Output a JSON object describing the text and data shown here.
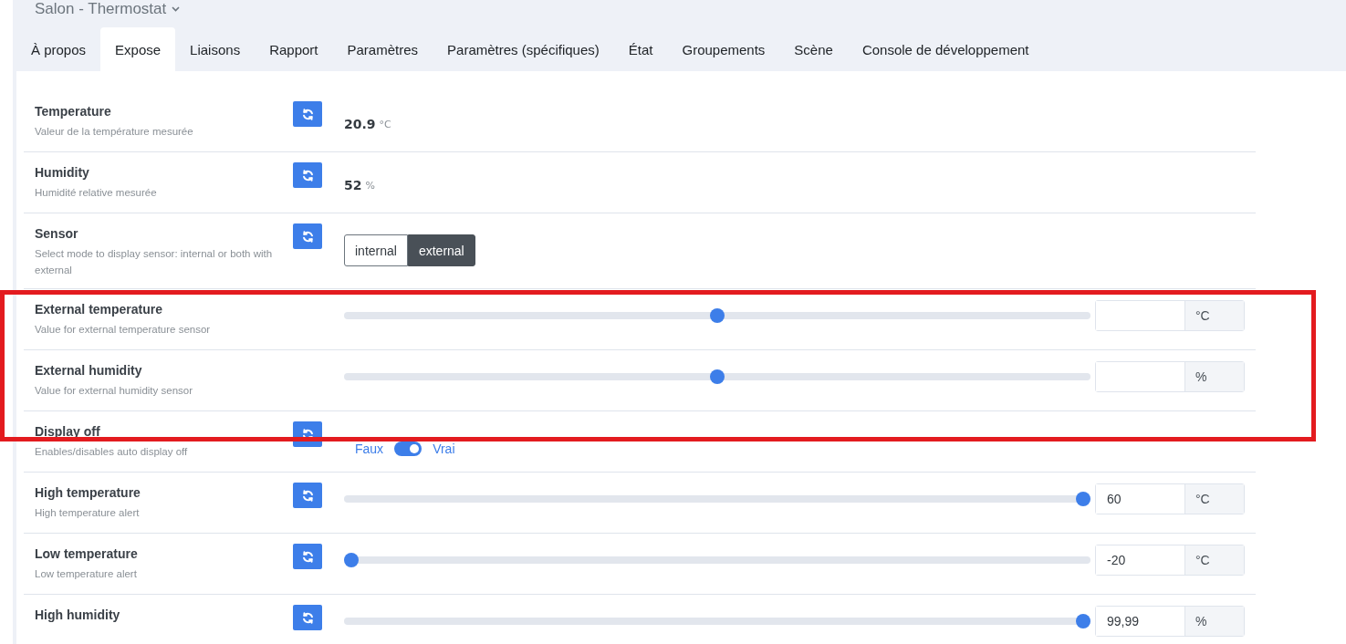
{
  "device": {
    "title": "Salon - Thermostat"
  },
  "tabs": [
    {
      "label": "À propos",
      "selected": false
    },
    {
      "label": "Expose",
      "selected": true
    },
    {
      "label": "Liaisons",
      "selected": false
    },
    {
      "label": "Rapport",
      "selected": false
    },
    {
      "label": "Paramètres",
      "selected": false
    },
    {
      "label": "Paramètres (spécifiques)",
      "selected": false
    },
    {
      "label": "État",
      "selected": false
    },
    {
      "label": "Groupements",
      "selected": false
    },
    {
      "label": "Scène",
      "selected": false
    },
    {
      "label": "Console de développement",
      "selected": false
    }
  ],
  "rows": [
    {
      "kind": "reading",
      "name": "Temperature",
      "description": "Valeur de la température mesurée",
      "refresh": true,
      "value": "20.9",
      "unit": "°C"
    },
    {
      "kind": "reading",
      "name": "Humidity",
      "description": "Humidité relative mesurée",
      "refresh": true,
      "value": "52",
      "unit": "%"
    },
    {
      "kind": "enum",
      "name": "Sensor",
      "description": "Select mode to display sensor: internal or both with external",
      "refresh": true,
      "options": [
        {
          "label": "internal",
          "selected": false
        },
        {
          "label": "external",
          "selected": true
        }
      ]
    },
    {
      "kind": "slider",
      "name": "External temperature",
      "description": "Value for external temperature sensor",
      "refresh": false,
      "level": 0.5,
      "unit": "°C",
      "highlighted": true
    },
    {
      "kind": "slider",
      "name": "External humidity",
      "description": "Value for external humidity sensor",
      "refresh": false,
      "level": 0.5,
      "unit": "%",
      "highlighted": true
    },
    {
      "kind": "toggle",
      "name": "Display off",
      "description": "Enables/disables auto display off",
      "refresh": true,
      "off_label": "Faux",
      "on_label": "Vrai",
      "on": true
    },
    {
      "kind": "slider",
      "name": "High temperature",
      "description": "High temperature alert",
      "refresh": true,
      "level": 1,
      "value": "60",
      "unit": "°C"
    },
    {
      "kind": "slider",
      "name": "Low temperature",
      "description": "Low temperature alert",
      "refresh": true,
      "level": 0,
      "value": "-20",
      "unit": "°C"
    },
    {
      "kind": "slider",
      "name": "High humidity",
      "refresh": true,
      "level": 1,
      "value": "99,99",
      "unit": "%"
    }
  ]
}
